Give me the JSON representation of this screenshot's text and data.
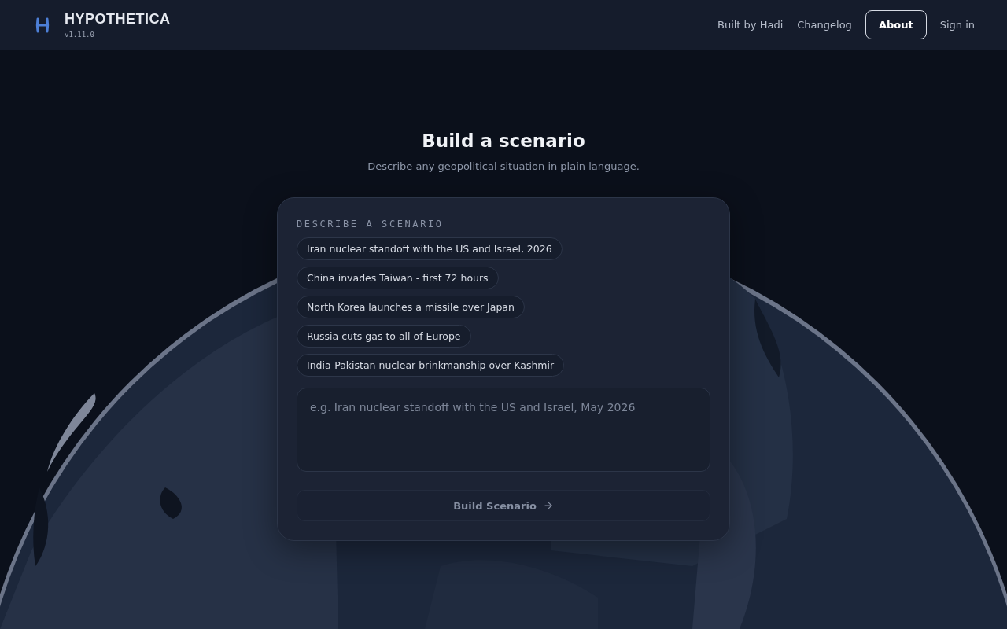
{
  "brand": {
    "name": "HYPOTHETICA",
    "version": "v1.11.0"
  },
  "nav": [
    {
      "label": "Built by Hadi",
      "selected": false
    },
    {
      "label": "Changelog",
      "selected": false
    },
    {
      "label": "About",
      "selected": true
    },
    {
      "label": "Sign in",
      "selected": false
    }
  ],
  "hero": {
    "title": "Build a scenario",
    "subtitle": "Describe any geopolitical situation in plain language."
  },
  "card": {
    "heading": "DESCRIBE A SCENARIO",
    "suggestions": [
      "Iran nuclear standoff with the US and Israel, 2026",
      "China invades Taiwan - first 72 hours",
      "North Korea launches a missile over Japan",
      "Russia cuts gas to all of Europe",
      "India-Pakistan nuclear brinkmanship over Kashmir"
    ],
    "input": {
      "placeholder": "e.g. Iran nuclear standoff with the US and Israel, May 2026"
    },
    "submit": {
      "label": "Build Scenario",
      "disabled": true
    }
  }
}
